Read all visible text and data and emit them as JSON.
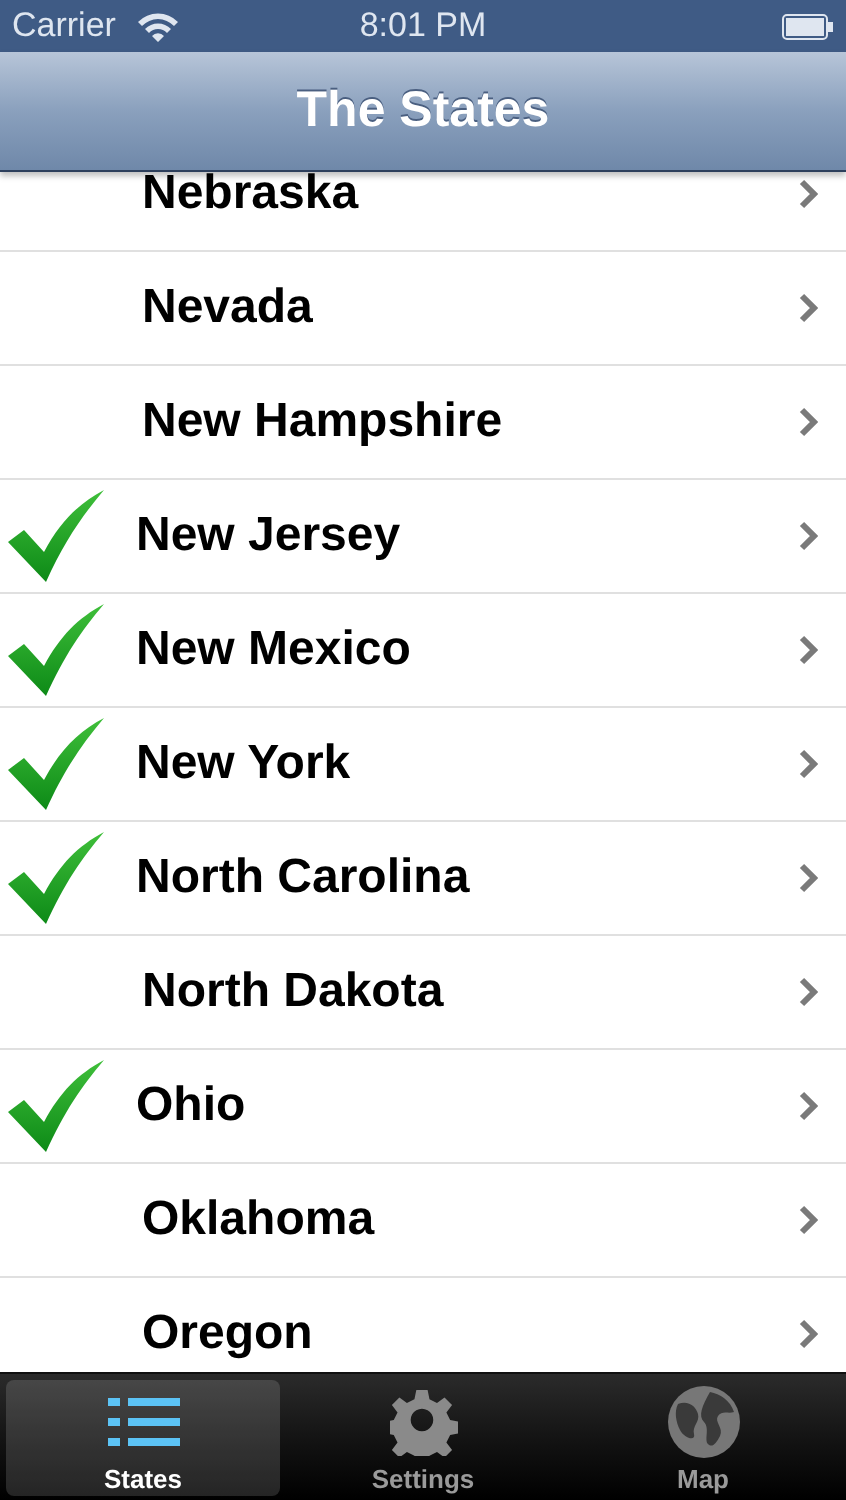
{
  "status_bar": {
    "carrier": "Carrier",
    "time": "8:01 PM"
  },
  "nav_bar": {
    "title": "The States"
  },
  "states": [
    {
      "name": "Nebraska",
      "checked": false
    },
    {
      "name": "Nevada",
      "checked": false
    },
    {
      "name": "New Hampshire",
      "checked": false
    },
    {
      "name": "New Jersey",
      "checked": true
    },
    {
      "name": "New Mexico",
      "checked": true
    },
    {
      "name": "New York",
      "checked": true
    },
    {
      "name": "North Carolina",
      "checked": true
    },
    {
      "name": "North Dakota",
      "checked": false
    },
    {
      "name": "Ohio",
      "checked": true
    },
    {
      "name": "Oklahoma",
      "checked": false
    },
    {
      "name": "Oregon",
      "checked": false
    }
  ],
  "tab_bar": [
    {
      "label": "States",
      "kind": "list",
      "selected": true
    },
    {
      "label": "Settings",
      "kind": "gear",
      "selected": false
    },
    {
      "label": "Map",
      "kind": "globe",
      "selected": false
    }
  ]
}
